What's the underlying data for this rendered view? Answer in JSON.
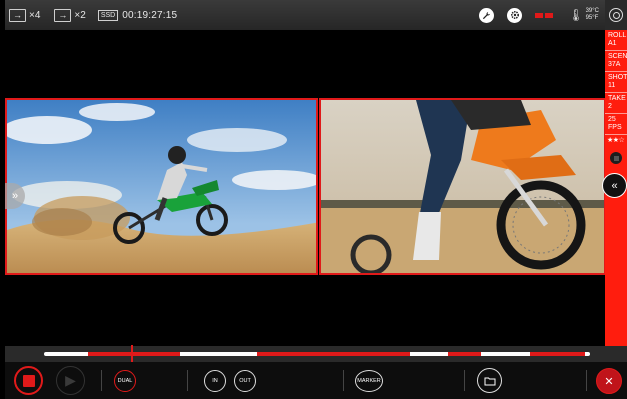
{
  "topbar": {
    "output1_multiplier": "×4",
    "output2_multiplier": "×2",
    "media_label": "SSD",
    "timecode": "00:19:27:15",
    "temp_c": "39°C",
    "temp_f": "95°F"
  },
  "metadata": {
    "roll_label": "ROLL",
    "roll_value": "A1",
    "scene_label": "SCENE",
    "scene_value": "37A",
    "shot_label": "SHOT",
    "shot_value": "11",
    "take_label": "TAKE",
    "take_value": "2",
    "fps": "25 FPS",
    "rating": "★★☆"
  },
  "timeline": {
    "playhead_fraction": 0.16,
    "segments": [
      {
        "start": 0.08,
        "end": 0.25
      },
      {
        "start": 0.39,
        "end": 0.67
      },
      {
        "start": 0.74,
        "end": 0.8
      },
      {
        "start": 0.89,
        "end": 0.99
      }
    ]
  },
  "controls": {
    "dual_label": "DUAL",
    "in_label": "IN",
    "out_label": "OUT",
    "marker_label": "MARKER"
  },
  "colors": {
    "accent_red": "#e01a1a",
    "side_strip": "#ff1d0e"
  }
}
